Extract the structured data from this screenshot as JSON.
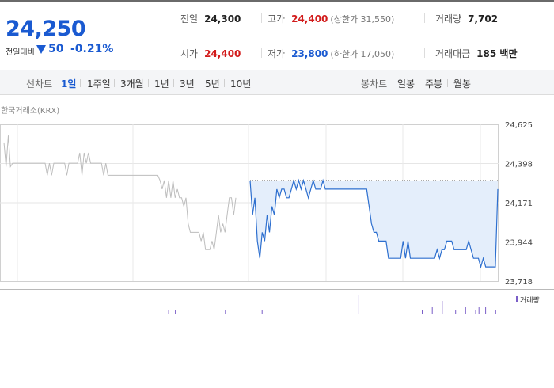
{
  "summary": {
    "price": "24,250",
    "change_label": "전일대비",
    "change_direction": "down",
    "change_abs": "50",
    "change_pct": "-0.21%",
    "stats": {
      "prev_close": {
        "label": "전일",
        "value": "24,300"
      },
      "high": {
        "label": "고가",
        "value": "24,400",
        "sub": "(상한가 31,550)"
      },
      "volume": {
        "label": "거래량",
        "value": "7,702"
      },
      "open": {
        "label": "시가",
        "value": "24,400"
      },
      "low": {
        "label": "저가",
        "value": "23,800",
        "sub": "(하한가 17,050)"
      },
      "trade_value": {
        "label": "거래대금",
        "value": "185 백만"
      }
    }
  },
  "tabs": {
    "line_label": "선차트",
    "line_tabs": [
      "1일",
      "1주일",
      "3개월",
      "1년",
      "3년",
      "5년",
      "10년"
    ],
    "active_line_tab": "1일",
    "candle_label": "봉차트",
    "candle_tabs": [
      "일봉",
      "주봉",
      "월봉"
    ]
  },
  "chart": {
    "exchange_label": "한국거래소(KRX)",
    "volume_legend": "거래량",
    "colors": {
      "prev_series": "#bdbdbd",
      "today_series": "#2d6fcf",
      "fill": "#e4eefb",
      "volume": "#7b5fc8"
    }
  },
  "chart_data": {
    "type": "line",
    "y_ticks": [
      "24,625",
      "24,398",
      "24,171",
      "23,944",
      "23,718"
    ],
    "ylim": [
      23718,
      24625
    ],
    "prev_close": 24300,
    "series": [
      {
        "values": [
          24520,
          24380,
          24560,
          24380,
          24400,
          24400,
          24400,
          24400,
          24400,
          24400,
          24400,
          24400,
          24400,
          24400,
          24400,
          24400,
          24400,
          24400,
          24400,
          24400,
          24330,
          24400,
          24330,
          24400,
          24400,
          24400,
          24400,
          24400,
          24400,
          24330,
          24400,
          24400,
          24400,
          24400,
          24400,
          24460,
          24330,
          24460,
          24400,
          24460,
          24400,
          24400,
          24400,
          24400,
          24400,
          24400,
          24330,
          24400,
          24330,
          24330,
          24330,
          24330,
          24330,
          24330,
          24330,
          24330,
          24330,
          24330,
          24330,
          24330,
          24330,
          24330,
          24330,
          24330,
          24330,
          24330,
          24330,
          24330,
          24330,
          24330,
          24330,
          24330,
          24300,
          24250,
          24300,
          24200,
          24300,
          24200,
          24300,
          24200,
          24250,
          24200,
          24200,
          24150,
          24200,
          24050,
          24000,
          24000,
          24000,
          24000,
          24000,
          23950,
          24000,
          23900,
          23900,
          23900,
          23950,
          23900,
          24000,
          24100,
          24000,
          24050,
          24000,
          24100,
          24200,
          24200,
          24100,
          24200
        ]
      },
      {
        "values": [
          24300,
          24100,
          24200,
          23950,
          23850,
          24000,
          23950,
          24100,
          24000,
          24150,
          24100,
          24250,
          24200,
          24250,
          24250,
          24200,
          24200,
          24250,
          24300,
          24250,
          24300,
          24250,
          24300,
          24250,
          24200,
          24250,
          24300,
          24250,
          24250,
          24250,
          24300,
          24250,
          24250,
          24250,
          24250,
          24250,
          24250,
          24250,
          24250,
          24250,
          24250,
          24250,
          24250,
          24250,
          24250,
          24250,
          24250,
          24250,
          24250,
          24150,
          24050,
          24000,
          24000,
          23950,
          23950,
          23950,
          23950,
          23850,
          23850,
          23850,
          23850,
          23850,
          23850,
          23950,
          23850,
          23950,
          23850,
          23850,
          23850,
          23850,
          23850,
          23850,
          23850,
          23850,
          23850,
          23850,
          23850,
          23900,
          23850,
          23900,
          23900,
          23950,
          23950,
          23950,
          23900,
          23900,
          23900,
          23900,
          23900,
          23900,
          23950,
          23900,
          23850,
          23850,
          23850,
          23800,
          23850,
          23800,
          23800,
          23800,
          23800,
          23800,
          24250
        ]
      }
    ],
    "volume": [
      0,
      0,
      0,
      1,
      0,
      1,
      0,
      0,
      0,
      0,
      0,
      0,
      0,
      0,
      0,
      0,
      0,
      0,
      0,
      0,
      1,
      0,
      0,
      0,
      0,
      0,
      0,
      0,
      0,
      0,
      0,
      1,
      0,
      0,
      0,
      0,
      0,
      0,
      0,
      0,
      0,
      0,
      0,
      0,
      0,
      0,
      0,
      0,
      0,
      0,
      0,
      0,
      0,
      0,
      0,
      0,
      0,
      0,
      0,
      0,
      6,
      0,
      0,
      0,
      0,
      0,
      0,
      0,
      0,
      0,
      0,
      0,
      0,
      0,
      0,
      0,
      0,
      0,
      0,
      1,
      0,
      0,
      2,
      0,
      0,
      4,
      0,
      0,
      0,
      1,
      0,
      0,
      2,
      0,
      0,
      1,
      2,
      0,
      2,
      0,
      0,
      1,
      5
    ]
  }
}
